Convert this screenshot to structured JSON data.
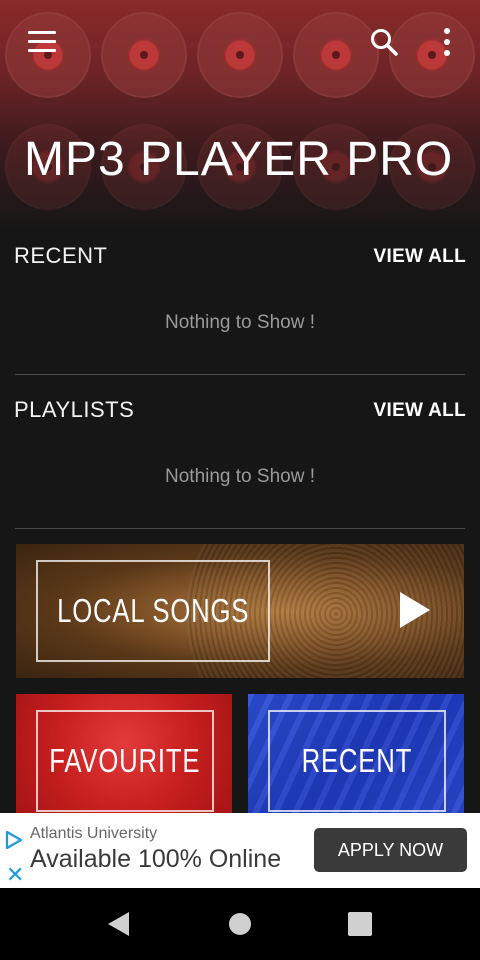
{
  "app": {
    "title": "MP3 PLAYER PRO"
  },
  "icons": {
    "menu": "hamburger-menu",
    "search": "magnifier",
    "more": "vertical-dots"
  },
  "sections": {
    "recent": {
      "title": "RECENT",
      "view_all": "VIEW ALL",
      "empty_text": "Nothing to Show !"
    },
    "playlists": {
      "title": "PLAYLISTS",
      "view_all": "VIEW ALL",
      "empty_text": "Nothing to Show !"
    }
  },
  "tiles": {
    "local_songs": "LOCAL SONGS",
    "favourite": "FAVOURITE",
    "recent": "RECENT"
  },
  "ad": {
    "sponsor": "Atlantis University",
    "headline": "Available 100% Online",
    "cta": "APPLY NOW"
  },
  "colors": {
    "accent": "#8a2a2a",
    "background": "#161616",
    "favourite_tile": "#c81f1f",
    "recent_tile": "#2540c8",
    "ad_icon": "#1a9be0"
  }
}
